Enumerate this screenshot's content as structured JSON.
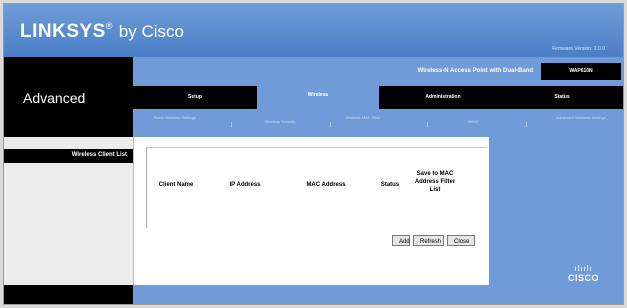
{
  "brand": {
    "logo": "LINKSYS",
    "registered_mark": "®",
    "by": "by Cisco",
    "firmware": "Firmware Version: 1.0.0"
  },
  "section": {
    "title": "Advanced"
  },
  "product": {
    "name": "Wireless-N Access Point with Dual-Band",
    "model": "WAP610N"
  },
  "tabs": [
    {
      "label": "Setup"
    },
    {
      "label": "Wireless"
    },
    {
      "label": "Administration"
    },
    {
      "label": "Status"
    }
  ],
  "subtabs": [
    {
      "label": "Basic Wireless Settings"
    },
    {
      "label": "Wireless Security"
    },
    {
      "label": "Wireless MAC Filter"
    },
    {
      "label": "WMM"
    },
    {
      "label": "Advanced Wireless Settings"
    }
  ],
  "sidebar": {
    "label": "Wireless Client List"
  },
  "table": {
    "headers": [
      "Client Name",
      "IP Address",
      "MAC Address",
      "Status",
      "Save to MAC Address Filter List"
    ],
    "empty_cells": [
      "--",
      "--",
      "--"
    ]
  },
  "buttons": {
    "apply": "Add",
    "refresh": "Refresh",
    "close": "Close"
  },
  "cisco": {
    "bars": "ılıılı",
    "text": "CISCO"
  }
}
